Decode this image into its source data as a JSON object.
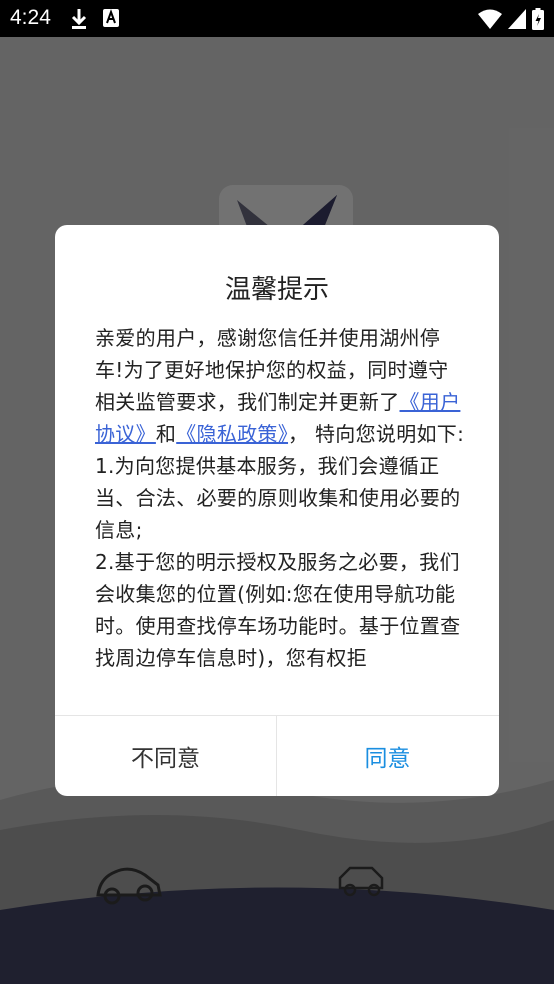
{
  "status_bar": {
    "time": "4:24",
    "icons_left": [
      "download-icon",
      "a-badge-icon"
    ],
    "icons_right": [
      "wifi-icon",
      "signal-icon",
      "battery-icon"
    ]
  },
  "dialog": {
    "title": "温馨提示",
    "intro_text": "亲爱的用户，感谢您信任并使用湖州停车!为了更好地保护您的权益，同时遵守相关监管要求，我们制定并更新了",
    "user_agreement_link": "《用户协议》",
    "and_text": "和",
    "privacy_policy_link": "《隐私政策》",
    "after_links_text": "， 特向您说明如下:",
    "item_1": "1.为向您提供基本服务，我们会遵循正当、合法、必要的原则收集和使用必要的信息;",
    "item_2": "2.基于您的明示授权及服务之必要，我们会收集您的位置(例如:您在使用导航功能时。使用查找停车场功能时。基于位置查找周边停车信息时)，您有权拒",
    "decline_label": "不同意",
    "agree_label": "同意"
  },
  "colors": {
    "link": "#3a63d6",
    "agree": "#1a8ee0"
  }
}
